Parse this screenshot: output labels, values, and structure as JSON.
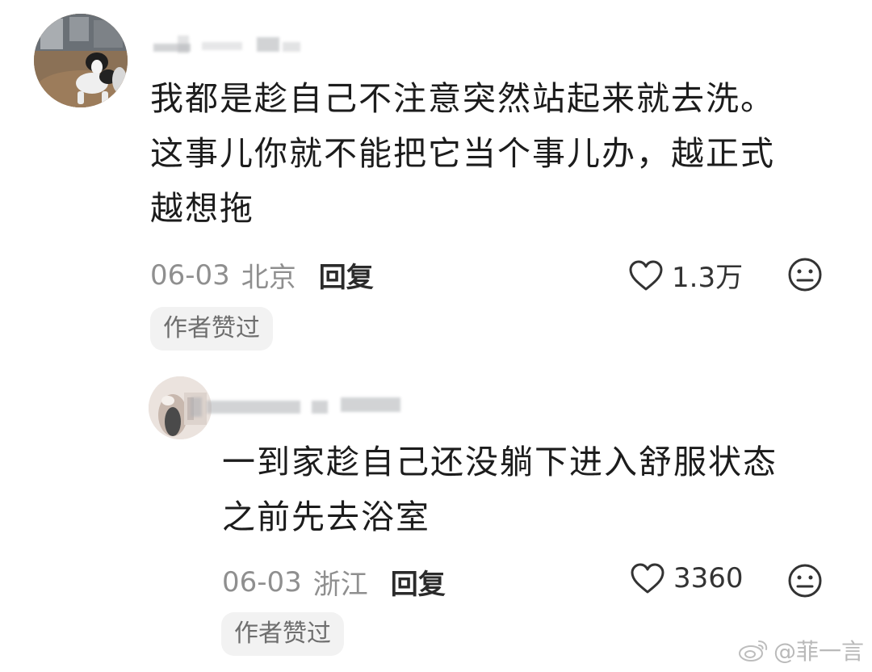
{
  "comments": [
    {
      "text": "我都是趁自己不注意突然站起来就去洗。\n这事儿你就不能把它当个事儿办，越正式\n越想拖",
      "date": "06-03",
      "region": "北京",
      "reply_label": "回复",
      "likes": "1.3万",
      "author_badge": "作者赞过",
      "avatar_icon": "dog-photo-avatar",
      "username_blurred": true
    },
    {
      "text": "一到家趁自己还没躺下进入舒服状态\n之前先去浴室",
      "date": "06-03",
      "region": "浙江",
      "reply_label": "回复",
      "likes": "3360",
      "author_badge": "作者赞过",
      "avatar_icon": "person-photo-avatar",
      "username_blurred": true
    }
  ],
  "icons": {
    "like": "heart-outline-icon",
    "emoji": "neutral-face-icon",
    "watermark": "weibo-logo-icon"
  },
  "watermark": {
    "text": "@菲一言"
  },
  "colors": {
    "meta_text": "#8f8f8f",
    "badge_bg": "#f2f2f2",
    "main_text": "#1c1c1c"
  }
}
